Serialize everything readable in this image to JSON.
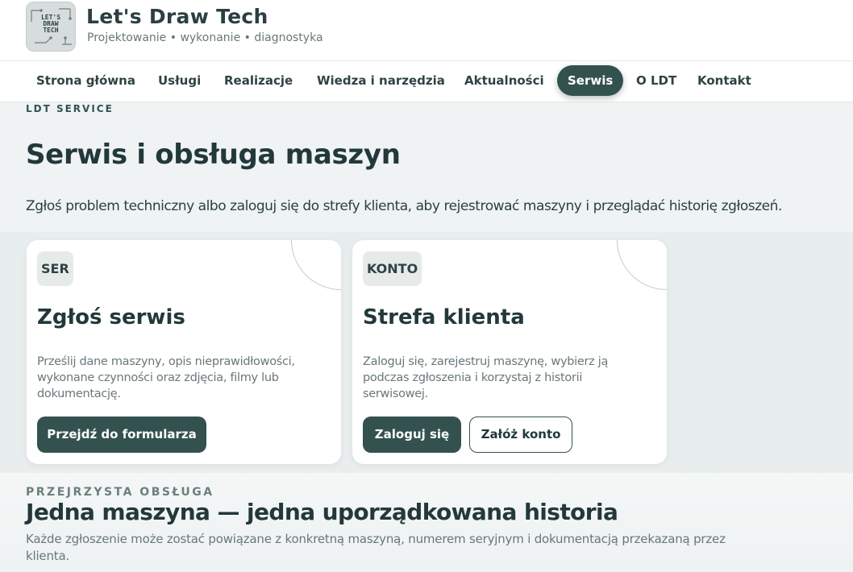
{
  "header": {
    "logo_text": "LET'S\nDRAW\nTECH",
    "title": "Let's Draw Tech",
    "tagline": "Projektowanie • wykonanie • diagnostyka"
  },
  "nav": {
    "items": [
      {
        "label": "Strona główna"
      },
      {
        "label": "Usługi"
      },
      {
        "label": "Realizacje"
      },
      {
        "label": "Wiedza i narzędzia"
      },
      {
        "label": "Aktualności"
      },
      {
        "label": "Serwis",
        "active": true
      },
      {
        "label": "O LDT"
      },
      {
        "label": "Kontakt"
      }
    ]
  },
  "hero": {
    "eyebrow": "LDT SERVICE",
    "title": "Serwis i obsługa maszyn",
    "description": "Zgłoś problem techniczny albo zaloguj się do strefy klienta, aby rejestrować maszyny i przeglądać historię zgłoszeń."
  },
  "cards": [
    {
      "badge": "SER",
      "title": "Zgłoś serwis",
      "text": "Prześlij dane maszyny, opis nieprawidłowości, wykonane czynności oraz zdjęcia, filmy lub dokumentację.",
      "primary_button": "Przejdź do formularza"
    },
    {
      "badge": "KONTO",
      "title": "Strefa klienta",
      "text": "Zaloguj się, zarejestruj maszynę, wybierz ją podczas zgłoszenia i korzystaj z historii serwisowej.",
      "primary_button": "Zaloguj się",
      "secondary_button": "Załóż konto"
    }
  ],
  "section": {
    "eyebrow": "PRZEJRZYSTA OBSŁUGA",
    "title": "Jedna maszyna — jedna uporządkowana historia",
    "text": "Każde zgłoszenie może zostać powiązane z konkretną maszyną, numerem seryjnym i dokumentacją przekazaną przez klienta."
  },
  "colors": {
    "accent": "#33524f",
    "text_dark": "#23383b",
    "text_muted": "#68777a",
    "hero_bg": "#eff3f3",
    "cards_bg": "#e8eded"
  }
}
